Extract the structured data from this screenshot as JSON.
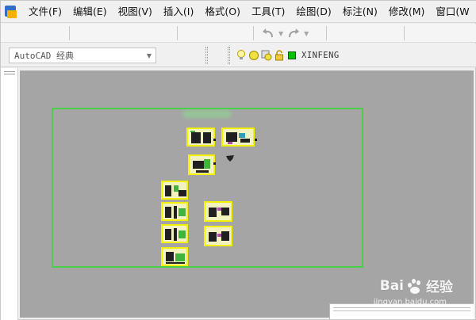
{
  "menu": {
    "items": [
      "文件(F)",
      "编辑(E)",
      "视图(V)",
      "插入(I)",
      "格式(O)",
      "工具(T)",
      "绘图(D)",
      "标注(N)",
      "修改(M)",
      "窗口(W"
    ]
  },
  "workspace": {
    "selected": "AutoCAD 经典"
  },
  "layer": {
    "name": "XINFENG",
    "color": "#00c000"
  },
  "colors": {
    "canvas_bg": "#a5a5a5",
    "border_green": "#48d048",
    "sheet_yellow": "#f3f000"
  },
  "watermark": {
    "brand": "Bai",
    "brand_suffix": "经验",
    "url": "jingyan.baidu.com"
  },
  "icons": {
    "app": "autocad-app-icon",
    "undo": "undo-arrow-icon",
    "redo": "redo-arrow-icon",
    "layer_bulb": "lightbulb-icon",
    "layer_sun": "sun-freeze-icon",
    "layer_sun2": "viewport-freeze-icon",
    "layer_lock": "lock-icon",
    "layer_color": "color-square-icon"
  }
}
